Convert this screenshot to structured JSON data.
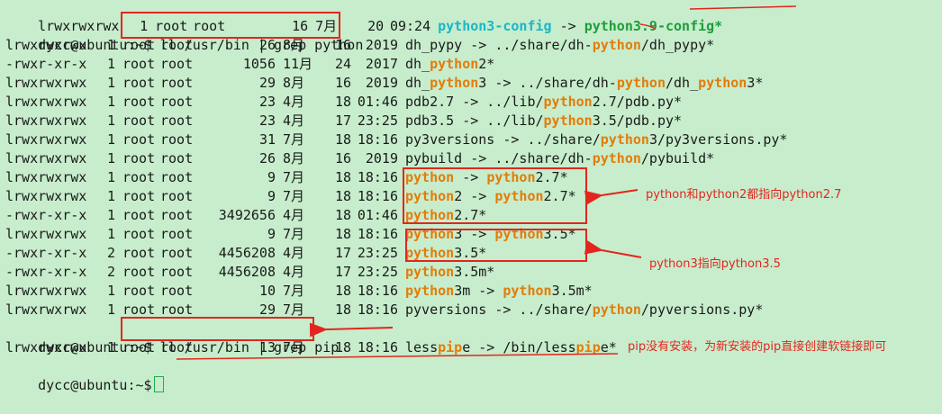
{
  "terminal": {
    "top_partial": {
      "perm": "lrwxrwxrwx",
      "links": "1",
      "owner": "root",
      "group": "root",
      "size": "16",
      "month": "7月",
      "day": "20",
      "time": "09:24",
      "name": "python3-config",
      "arrow": "->",
      "target": "python3.9-config*"
    },
    "prompt1": "dycc@ubuntu:~$",
    "command1": "ll /usr/bin | grep python",
    "rows": [
      {
        "perm": "lrwxrwxrwx",
        "links": "1",
        "owner": "root",
        "group": "root",
        "size": "26",
        "month": "8月",
        "day": "16",
        "time": "2019",
        "segs": [
          {
            "t": "dh_pypy -> ../share/dh-"
          },
          {
            "t": "python",
            "h": true
          },
          {
            "t": "/dh_pypy*"
          }
        ]
      },
      {
        "perm": "-rwxr-xr-x",
        "links": "1",
        "owner": "root",
        "group": "root",
        "size": "1056",
        "month": "11月",
        "day": "24",
        "time": "2017",
        "segs": [
          {
            "t": "dh_"
          },
          {
            "t": "python",
            "h": true
          },
          {
            "t": "2*"
          }
        ]
      },
      {
        "perm": "lrwxrwxrwx",
        "links": "1",
        "owner": "root",
        "group": "root",
        "size": "29",
        "month": "8月",
        "day": "16",
        "time": "2019",
        "segs": [
          {
            "t": "dh_"
          },
          {
            "t": "python",
            "h": true
          },
          {
            "t": "3 -> ../share/dh-"
          },
          {
            "t": "python",
            "h": true
          },
          {
            "t": "/dh_"
          },
          {
            "t": "python",
            "h": true
          },
          {
            "t": "3*"
          }
        ]
      },
      {
        "perm": "lrwxrwxrwx",
        "links": "1",
        "owner": "root",
        "group": "root",
        "size": "23",
        "month": "4月",
        "day": "18",
        "time": "01:46",
        "segs": [
          {
            "t": "pdb2.7 -> ../lib/"
          },
          {
            "t": "python",
            "h": true
          },
          {
            "t": "2.7/pdb.py*"
          }
        ]
      },
      {
        "perm": "lrwxrwxrwx",
        "links": "1",
        "owner": "root",
        "group": "root",
        "size": "23",
        "month": "4月",
        "day": "17",
        "time": "23:25",
        "segs": [
          {
            "t": "pdb3.5 -> ../lib/"
          },
          {
            "t": "python",
            "h": true
          },
          {
            "t": "3.5/pdb.py*"
          }
        ]
      },
      {
        "perm": "lrwxrwxrwx",
        "links": "1",
        "owner": "root",
        "group": "root",
        "size": "31",
        "month": "7月",
        "day": "18",
        "time": "18:16",
        "segs": [
          {
            "t": "py3versions -> ../share/"
          },
          {
            "t": "python",
            "h": true
          },
          {
            "t": "3/py3versions.py*"
          }
        ]
      },
      {
        "perm": "lrwxrwxrwx",
        "links": "1",
        "owner": "root",
        "group": "root",
        "size": "26",
        "month": "8月",
        "day": "16",
        "time": "2019",
        "segs": [
          {
            "t": "pybuild -> ../share/dh-"
          },
          {
            "t": "python",
            "h": true
          },
          {
            "t": "/pybuild*"
          }
        ]
      },
      {
        "perm": "lrwxrwxrwx",
        "links": "1",
        "owner": "root",
        "group": "root",
        "size": "9",
        "month": "7月",
        "day": "18",
        "time": "18:16",
        "segs": [
          {
            "t": "python",
            "h": true
          },
          {
            "t": " -> "
          },
          {
            "t": "python",
            "h": true
          },
          {
            "t": "2.7*"
          }
        ]
      },
      {
        "perm": "lrwxrwxrwx",
        "links": "1",
        "owner": "root",
        "group": "root",
        "size": "9",
        "month": "7月",
        "day": "18",
        "time": "18:16",
        "segs": [
          {
            "t": "python",
            "h": true
          },
          {
            "t": "2 -> "
          },
          {
            "t": "python",
            "h": true
          },
          {
            "t": "2.7*"
          }
        ]
      },
      {
        "perm": "-rwxr-xr-x",
        "links": "1",
        "owner": "root",
        "group": "root",
        "size": "3492656",
        "month": "4月",
        "day": "18",
        "time": "01:46",
        "segs": [
          {
            "t": "python",
            "h": true
          },
          {
            "t": "2.7*"
          }
        ]
      },
      {
        "perm": "lrwxrwxrwx",
        "links": "1",
        "owner": "root",
        "group": "root",
        "size": "9",
        "month": "7月",
        "day": "18",
        "time": "18:16",
        "segs": [
          {
            "t": "python",
            "h": true
          },
          {
            "t": "3 -> "
          },
          {
            "t": "python",
            "h": true
          },
          {
            "t": "3.5*"
          }
        ]
      },
      {
        "perm": "-rwxr-xr-x",
        "links": "2",
        "owner": "root",
        "group": "root",
        "size": "4456208",
        "month": "4月",
        "day": "17",
        "time": "23:25",
        "segs": [
          {
            "t": "python",
            "h": true
          },
          {
            "t": "3.5*"
          }
        ]
      },
      {
        "perm": "-rwxr-xr-x",
        "links": "2",
        "owner": "root",
        "group": "root",
        "size": "4456208",
        "month": "4月",
        "day": "17",
        "time": "23:25",
        "segs": [
          {
            "t": "python",
            "h": true
          },
          {
            "t": "3.5m*"
          }
        ]
      },
      {
        "perm": "lrwxrwxrwx",
        "links": "1",
        "owner": "root",
        "group": "root",
        "size": "10",
        "month": "7月",
        "day": "18",
        "time": "18:16",
        "segs": [
          {
            "t": "python",
            "h": true
          },
          {
            "t": "3m -> "
          },
          {
            "t": "python",
            "h": true
          },
          {
            "t": "3.5m*"
          }
        ]
      },
      {
        "perm": "lrwxrwxrwx",
        "links": "1",
        "owner": "root",
        "group": "root",
        "size": "29",
        "month": "7月",
        "day": "18",
        "time": "18:16",
        "segs": [
          {
            "t": "pyversions -> ../share/"
          },
          {
            "t": "python",
            "h": true
          },
          {
            "t": "/pyversions.py*"
          }
        ]
      }
    ],
    "prompt2": "dycc@ubuntu:~$",
    "command2": "ll /usr/bin | grep pip",
    "pip_row": {
      "perm": "lrwxrwxrwx",
      "links": "1",
      "owner": "root",
      "group": "root",
      "size": "13",
      "month": "7月",
      "day": "18",
      "time": "18:16",
      "segs": [
        {
          "t": "less"
        },
        {
          "t": "pip",
          "h": true
        },
        {
          "t": "e -> /bin/less"
        },
        {
          "t": "pip",
          "h": true
        },
        {
          "t": "e*"
        }
      ]
    },
    "prompt3": "dycc@ubuntu:~$"
  },
  "annotations": {
    "note_python2": "python和python2都指向python2.7",
    "note_python3": "python3指向python3.5",
    "note_pip": "pip没有安装，为新安装的pip直接创建软链接即可"
  },
  "colors": {
    "background": "#c7edcc",
    "highlight": "#e37c0a",
    "annotation_red": "#e2261f",
    "cyan": "#19b7c9",
    "green": "#1d9e3b"
  }
}
